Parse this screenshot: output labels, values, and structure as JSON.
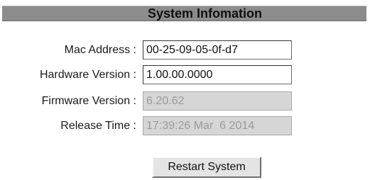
{
  "header": {
    "title": "System Infomation"
  },
  "fields": [
    {
      "label": "Mac Address  :",
      "value": "00-25-09-05-0f-d7",
      "editable": true
    },
    {
      "label": "Hardware Version :",
      "value": "1.00.00.0000",
      "editable": true
    },
    {
      "label": "Firmware Version :",
      "value": "6.20.62",
      "editable": false
    },
    {
      "label": "Release Time :",
      "value": "17:39:26 Mar  6 2014",
      "editable": false
    }
  ],
  "actions": {
    "restart_label": "Restart System"
  },
  "colors": {
    "title_bar": "#8c8c8c",
    "readonly_field": "#d6d6d6",
    "button_face": "#e4e4e4"
  }
}
